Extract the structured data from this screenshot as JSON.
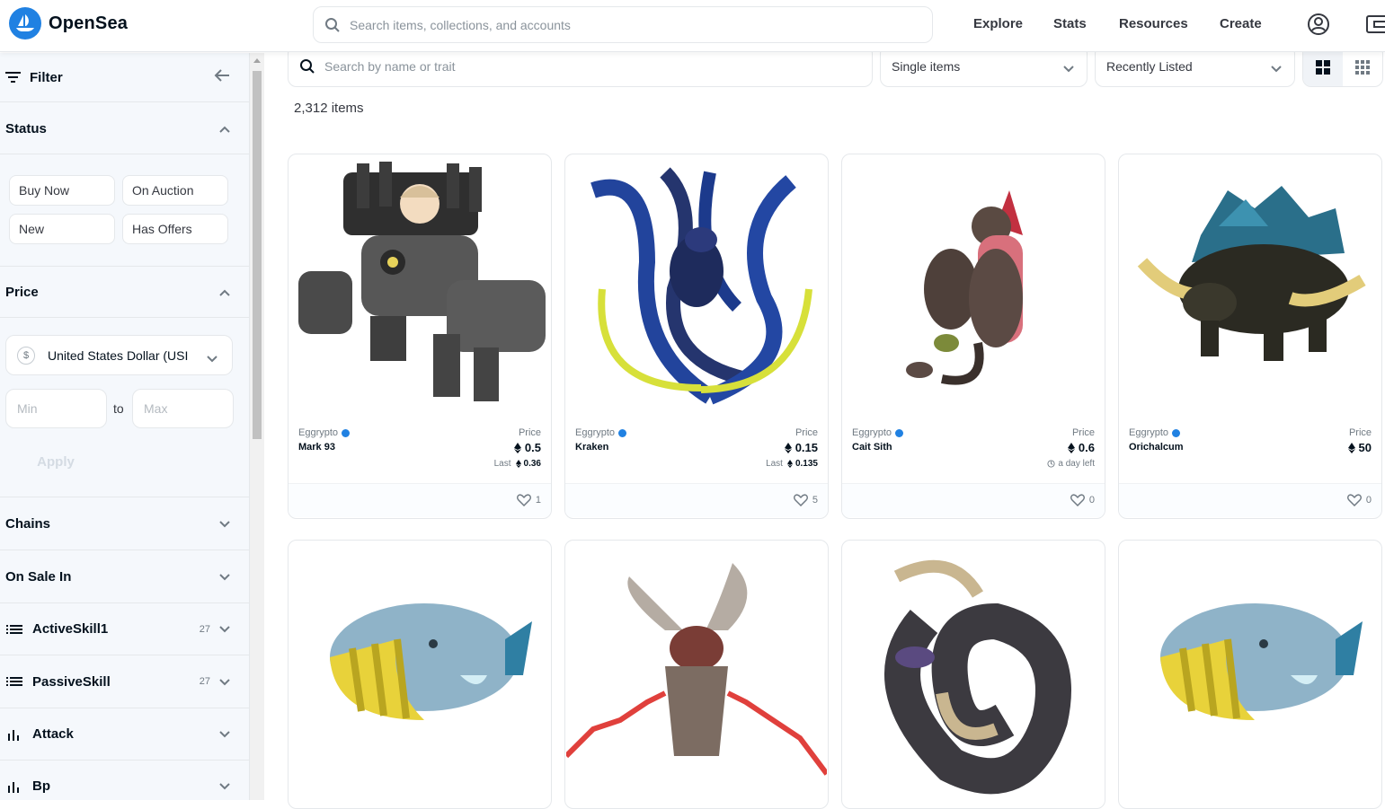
{
  "brand": {
    "name": "OpenSea",
    "accent": "#2081e2"
  },
  "header": {
    "search_placeholder": "Search items, collections, and accounts",
    "nav": [
      "Explore",
      "Stats",
      "Resources",
      "Create"
    ]
  },
  "sidebar": {
    "filter_label": "Filter",
    "status": {
      "title": "Status",
      "options": [
        "Buy Now",
        "On Auction",
        "New",
        "Has Offers"
      ]
    },
    "price": {
      "title": "Price",
      "currency_symbol": "$",
      "currency": "United States Dollar (USI",
      "min_placeholder": "Min",
      "to_label": "to",
      "max_placeholder": "Max",
      "apply_label": "Apply"
    },
    "sections": [
      {
        "label": "Chains",
        "icon": "none",
        "count": ""
      },
      {
        "label": "On Sale In",
        "icon": "none",
        "count": ""
      },
      {
        "label": "ActiveSkill1",
        "icon": "list-icon",
        "count": "27"
      },
      {
        "label": "PassiveSkill",
        "icon": "list-icon",
        "count": "27"
      },
      {
        "label": "Attack",
        "icon": "bar-chart-icon",
        "count": ""
      },
      {
        "label": "Bp",
        "icon": "bar-chart-icon",
        "count": ""
      }
    ]
  },
  "toolbar": {
    "search_placeholder": "Search by name or trait",
    "type_select": "Single items",
    "sort_select": "Recently Listed"
  },
  "items_count": "2,312 items",
  "cards": [
    {
      "collection": "Eggrypto",
      "name": "Mark 93",
      "price_label": "Price",
      "price": "0.5",
      "last_label": "Last",
      "last": "0.36",
      "time_left": "",
      "likes": "1"
    },
    {
      "collection": "Eggrypto",
      "name": "Kraken",
      "price_label": "Price",
      "price": "0.15",
      "last_label": "Last",
      "last": "0.135",
      "time_left": "",
      "likes": "5"
    },
    {
      "collection": "Eggrypto",
      "name": "Cait Sith",
      "price_label": "Price",
      "price": "0.6",
      "last_label": "",
      "last": "",
      "time_left": "a day left",
      "likes": "0"
    },
    {
      "collection": "Eggrypto",
      "name": "Orichalcum",
      "price_label": "Price",
      "price": "50",
      "last_label": "",
      "last": "",
      "time_left": "",
      "likes": "0"
    },
    {
      "collection": "",
      "name": "",
      "price_label": "",
      "price": "",
      "last_label": "",
      "last": "",
      "time_left": "",
      "likes": ""
    },
    {
      "collection": "",
      "name": "",
      "price_label": "",
      "price": "",
      "last_label": "",
      "last": "",
      "time_left": "",
      "likes": ""
    },
    {
      "collection": "",
      "name": "",
      "price_label": "",
      "price": "",
      "last_label": "",
      "last": "",
      "time_left": "",
      "likes": ""
    },
    {
      "collection": "",
      "name": "",
      "price_label": "",
      "price": "",
      "last_label": "",
      "last": "",
      "time_left": "",
      "likes": ""
    }
  ]
}
